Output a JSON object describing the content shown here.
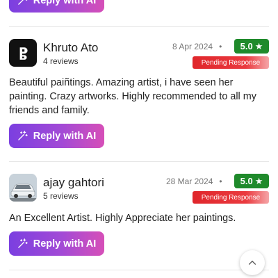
{
  "reply_label": "Reply with AI",
  "reviews": [
    {
      "name": "Khruto Ato",
      "reviews_count": "4 reviews",
      "date": "8 Apr 2024",
      "rating": "5.0",
      "status": "Pending Response",
      "text": "Beautiful paiñtings. Amazing artist, i have seen her painting. Crazy artworks. Highly recommended to all my friends and family.",
      "avatar_icon": "letter-avatar"
    },
    {
      "name": "ajay gahtori",
      "reviews_count": "5 reviews",
      "date": "28 Mar 2024",
      "rating": "5.0",
      "status": "Pending Response",
      "text": "An Excellent Artist. Highly Appreciate her paintings.",
      "avatar_icon": "car-photo-avatar"
    }
  ],
  "icons": {
    "reply": "magic-wand-icon",
    "rating": "star-icon",
    "scroll": "chevron-up-icon"
  },
  "colors": {
    "button_gradient_start": "#7b3fe0",
    "button_gradient_end": "#d64fb8",
    "rating_bg": "#1f8a2b",
    "status_bg": "#e0262b"
  }
}
